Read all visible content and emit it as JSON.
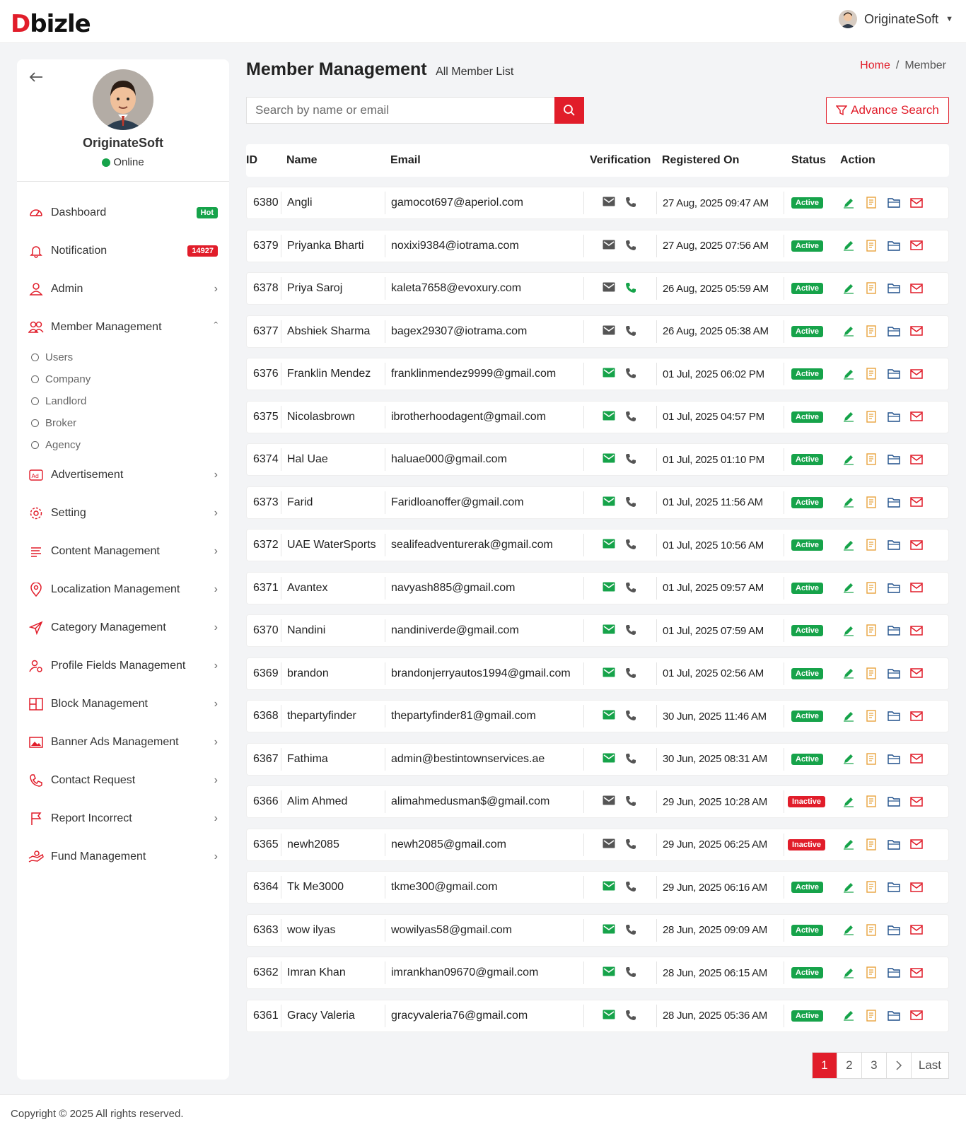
{
  "brand": {
    "logo_mark": "D",
    "logo_rest": "bizle"
  },
  "header": {
    "user_name": "OriginateSoft"
  },
  "sidebar": {
    "profile_name": "OriginateSoft",
    "profile_status": "Online",
    "items": [
      {
        "label": "Dashboard",
        "badge": "Hot",
        "icon": "dashboard-icon"
      },
      {
        "label": "Notification",
        "badge": "14927",
        "icon": "bell-icon"
      },
      {
        "label": "Admin",
        "icon": "user-icon"
      },
      {
        "label": "Member Management",
        "icon": "users-icon",
        "expanded": true
      },
      {
        "label": "Advertisement",
        "icon": "ad-icon"
      },
      {
        "label": "Setting",
        "icon": "gear-icon"
      },
      {
        "label": "Content Management",
        "icon": "list-icon"
      },
      {
        "label": "Localization Management",
        "icon": "pin-icon"
      },
      {
        "label": "Category Management",
        "icon": "send-icon"
      },
      {
        "label": "Profile Fields Management",
        "icon": "user-gear-icon"
      },
      {
        "label": "Block Management",
        "icon": "block-icon"
      },
      {
        "label": "Banner Ads Management",
        "icon": "image-icon"
      },
      {
        "label": "Contact Request",
        "icon": "phone-icon"
      },
      {
        "label": "Report Incorrect",
        "icon": "flag-icon"
      },
      {
        "label": "Fund Management",
        "icon": "hand-icon"
      }
    ],
    "sub_items": [
      "Users",
      "Company",
      "Landlord",
      "Broker",
      "Agency"
    ]
  },
  "main": {
    "title": "Member Management",
    "subtitle": "All Member List",
    "breadcrumb_home": "Home",
    "breadcrumb_sep": "/",
    "breadcrumb_current": "Member",
    "search_placeholder": "Search by name or email",
    "advance_search": "Advance Search"
  },
  "table": {
    "headers": [
      "ID",
      "Name",
      "Email",
      "Verification",
      "Registered On",
      "Status",
      "Action"
    ],
    "rows": [
      {
        "id": "6380",
        "name": "Angli",
        "email": "gamocot697@aperiol.com",
        "email_verified": false,
        "phone_verified": false,
        "registered": "27 Aug, 2025 09:47 AM",
        "status": "Active"
      },
      {
        "id": "6379",
        "name": "Priyanka Bharti",
        "email": "noxixi9384@iotrama.com",
        "email_verified": false,
        "phone_verified": false,
        "registered": "27 Aug, 2025 07:56 AM",
        "status": "Active"
      },
      {
        "id": "6378",
        "name": "Priya Saroj",
        "email": "kaleta7658@evoxury.com",
        "email_verified": false,
        "phone_verified": true,
        "registered": "26 Aug, 2025 05:59 AM",
        "status": "Active"
      },
      {
        "id": "6377",
        "name": "Abshiek Sharma",
        "email": "bagex29307@iotrama.com",
        "email_verified": false,
        "phone_verified": false,
        "registered": "26 Aug, 2025 05:38 AM",
        "status": "Active"
      },
      {
        "id": "6376",
        "name": "Franklin Mendez",
        "email": "franklinmendez9999@gmail.com",
        "email_verified": true,
        "phone_verified": false,
        "registered": "01 Jul, 2025 06:02 PM",
        "status": "Active"
      },
      {
        "id": "6375",
        "name": "Nicolasbrown",
        "email": "ibrotherhoodagent@gmail.com",
        "email_verified": true,
        "phone_verified": false,
        "registered": "01 Jul, 2025 04:57 PM",
        "status": "Active"
      },
      {
        "id": "6374",
        "name": "Hal Uae",
        "email": "haluae000@gmail.com",
        "email_verified": true,
        "phone_verified": false,
        "registered": "01 Jul, 2025 01:10 PM",
        "status": "Active"
      },
      {
        "id": "6373",
        "name": "Farid",
        "email": "Faridloanoffer@gmail.com",
        "email_verified": true,
        "phone_verified": false,
        "registered": "01 Jul, 2025 11:56 AM",
        "status": "Active"
      },
      {
        "id": "6372",
        "name": "UAE WaterSports",
        "email": "sealifeadventurerak@gmail.com",
        "email_verified": true,
        "phone_verified": false,
        "registered": "01 Jul, 2025 10:56 AM",
        "status": "Active"
      },
      {
        "id": "6371",
        "name": "Avantex",
        "email": "navyash885@gmail.com",
        "email_verified": true,
        "phone_verified": false,
        "registered": "01 Jul, 2025 09:57 AM",
        "status": "Active"
      },
      {
        "id": "6370",
        "name": "Nandini",
        "email": "nandiniverde@gmail.com",
        "email_verified": true,
        "phone_verified": false,
        "registered": "01 Jul, 2025 07:59 AM",
        "status": "Active"
      },
      {
        "id": "6369",
        "name": "brandon",
        "email": "brandonjerryautos1994@gmail.com",
        "email_verified": true,
        "phone_verified": false,
        "registered": "01 Jul, 2025 02:56 AM",
        "status": "Active"
      },
      {
        "id": "6368",
        "name": "thepartyfinder",
        "email": "thepartyfinder81@gmail.com",
        "email_verified": true,
        "phone_verified": false,
        "registered": "30 Jun, 2025 11:46 AM",
        "status": "Active"
      },
      {
        "id": "6367",
        "name": "Fathima",
        "email": "admin@bestintownservices.ae",
        "email_verified": true,
        "phone_verified": false,
        "registered": "30 Jun, 2025 08:31 AM",
        "status": "Active"
      },
      {
        "id": "6366",
        "name": "Alim Ahmed",
        "email": "alimahmedusman$@gmail.com",
        "email_verified": false,
        "phone_verified": false,
        "registered": "29 Jun, 2025 10:28 AM",
        "status": "Inactive"
      },
      {
        "id": "6365",
        "name": "newh2085",
        "email": "newh2085@gmail.com",
        "email_verified": false,
        "phone_verified": false,
        "registered": "29 Jun, 2025 06:25 AM",
        "status": "Inactive"
      },
      {
        "id": "6364",
        "name": "Tk Me3000",
        "email": "tkme300@gmail.com",
        "email_verified": true,
        "phone_verified": false,
        "registered": "29 Jun, 2025 06:16 AM",
        "status": "Active"
      },
      {
        "id": "6363",
        "name": "wow ilyas",
        "email": "wowilyas58@gmail.com",
        "email_verified": true,
        "phone_verified": false,
        "registered": "28 Jun, 2025 09:09 AM",
        "status": "Active"
      },
      {
        "id": "6362",
        "name": "Imran Khan",
        "email": "imrankhan09670@gmail.com",
        "email_verified": true,
        "phone_verified": false,
        "registered": "28 Jun, 2025 06:15 AM",
        "status": "Active"
      },
      {
        "id": "6361",
        "name": "Gracy Valeria",
        "email": "gracyvaleria76@gmail.com",
        "email_verified": true,
        "phone_verified": false,
        "registered": "28 Jun, 2025 05:36 AM",
        "status": "Active"
      }
    ]
  },
  "pagination": {
    "pages": [
      "1",
      "2",
      "3"
    ],
    "current": "1",
    "next_symbol": ">",
    "last_label": "Last"
  },
  "footer": {
    "copyright": "Copyright © 2025 All rights reserved."
  },
  "colors": {
    "accent": "#e11d2a",
    "success": "#16a34a",
    "action_edit": "#16a34a",
    "action_doc": "#e8a33d",
    "action_folder": "#1e4f8a",
    "action_mail": "#e11d2a"
  }
}
